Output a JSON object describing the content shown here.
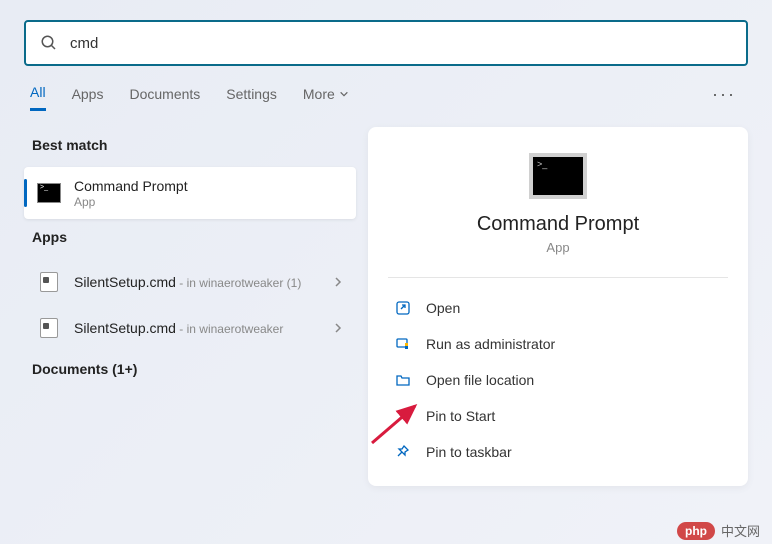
{
  "search": {
    "value": "cmd"
  },
  "tabs": {
    "items": [
      "All",
      "Apps",
      "Documents",
      "Settings",
      "More"
    ],
    "active_index": 0,
    "more_dots": "···"
  },
  "sections": {
    "best_match": {
      "title": "Best match",
      "item": {
        "name": "Command Prompt",
        "sub": "App"
      }
    },
    "apps": {
      "title": "Apps",
      "items": [
        {
          "name": "SilentSetup.cmd",
          "meta": " - in winaerotweaker (1)"
        },
        {
          "name": "SilentSetup.cmd",
          "meta": " - in winaerotweaker"
        }
      ]
    },
    "documents": {
      "title": "Documents (1+)"
    }
  },
  "preview": {
    "title": "Command Prompt",
    "sub": "App",
    "actions": [
      {
        "icon": "open",
        "label": "Open"
      },
      {
        "icon": "admin",
        "label": "Run as administrator"
      },
      {
        "icon": "folder",
        "label": "Open file location"
      },
      {
        "icon": "pin",
        "label": "Pin to Start"
      },
      {
        "icon": "pin",
        "label": "Pin to taskbar"
      }
    ]
  },
  "watermark": {
    "badge": "php",
    "text": "中文网"
  }
}
